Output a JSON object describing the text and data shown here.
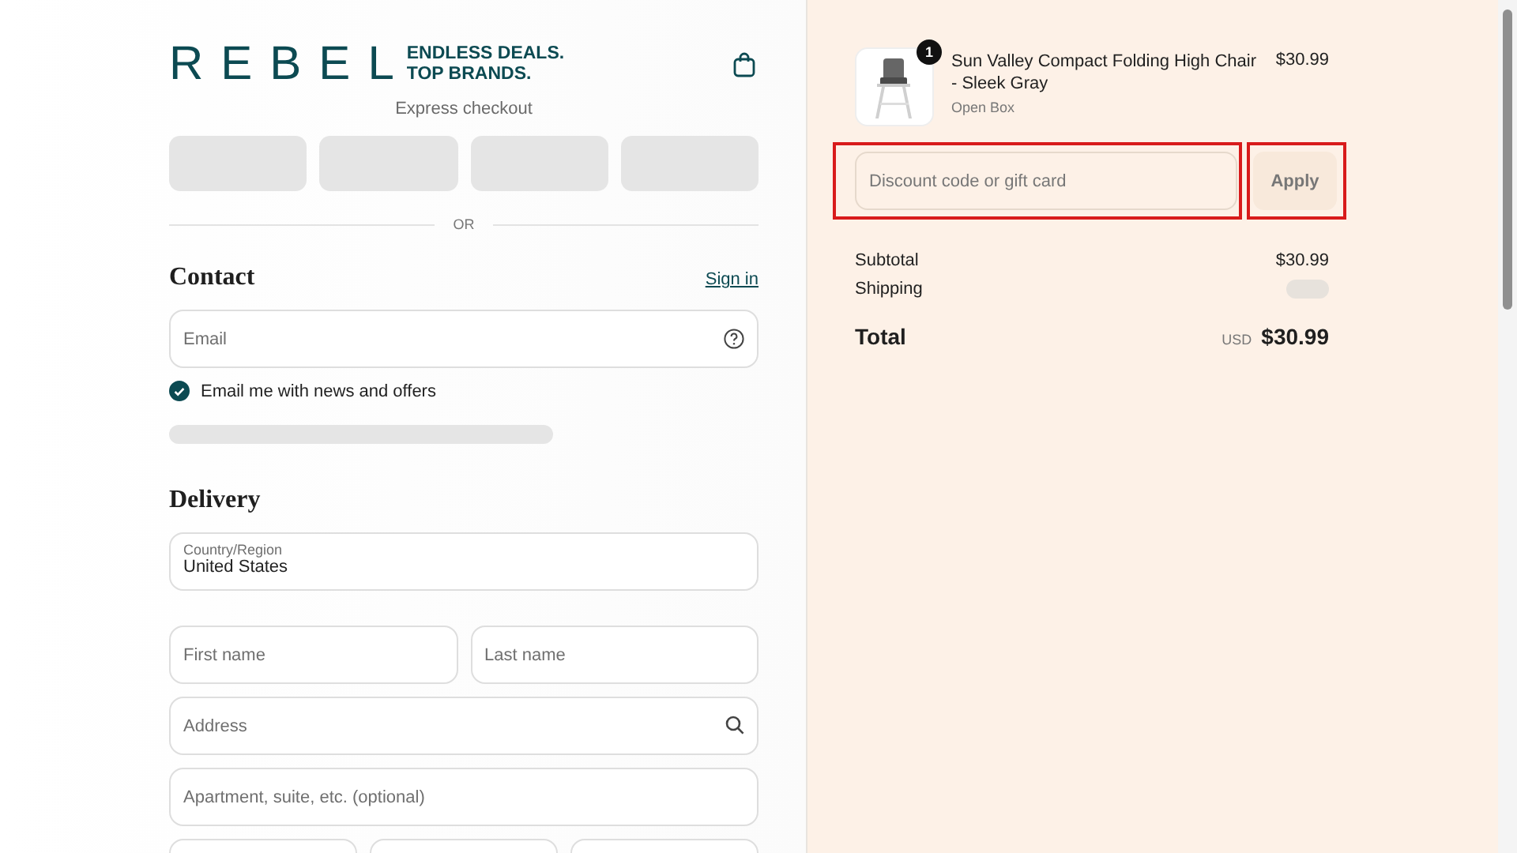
{
  "header": {
    "logo": "REBEL",
    "tagline_1": "ENDLESS DEALS.",
    "tagline_2": "TOP BRANDS."
  },
  "express_checkout": {
    "label": "Express checkout"
  },
  "divider": "OR",
  "contact": {
    "heading": "Contact",
    "sign_in": "Sign in",
    "email": {
      "placeholder": "Email"
    },
    "newsletter": {
      "label": "Email me with news and offers",
      "checked": true
    }
  },
  "delivery": {
    "heading": "Delivery",
    "country": {
      "label": "Country/Region",
      "value": "United States"
    },
    "rows": [
      {
        "fields": [
          {
            "placeholder": "First name",
            "kind": "text"
          },
          {
            "placeholder": "Last name",
            "kind": "text"
          }
        ]
      },
      {
        "fields": [
          {
            "placeholder": "Address",
            "kind": "search"
          }
        ]
      },
      {
        "fields": [
          {
            "placeholder": "Apartment, suite, etc. (optional)",
            "kind": "text"
          }
        ]
      },
      {
        "fields": [
          {
            "kind": "text"
          },
          {
            "kind": "text"
          },
          {
            "kind": "text"
          }
        ]
      }
    ]
  },
  "order": {
    "item": {
      "name": "Sun Valley Compact Folding High Chair - Sleek Gray",
      "variant": "Open Box",
      "price": "$30.99",
      "quantity": "1"
    },
    "discount": {
      "placeholder": "Discount code or gift card",
      "highlighted": true
    },
    "apply_button": {
      "label": "Apply",
      "highlighted": true
    },
    "subtotal": {
      "label": "Subtotal",
      "value": "$30.99"
    },
    "shipping": {
      "label": "Shipping"
    },
    "total": {
      "label": "Total",
      "currency": "USD",
      "value": "$30.99"
    }
  }
}
